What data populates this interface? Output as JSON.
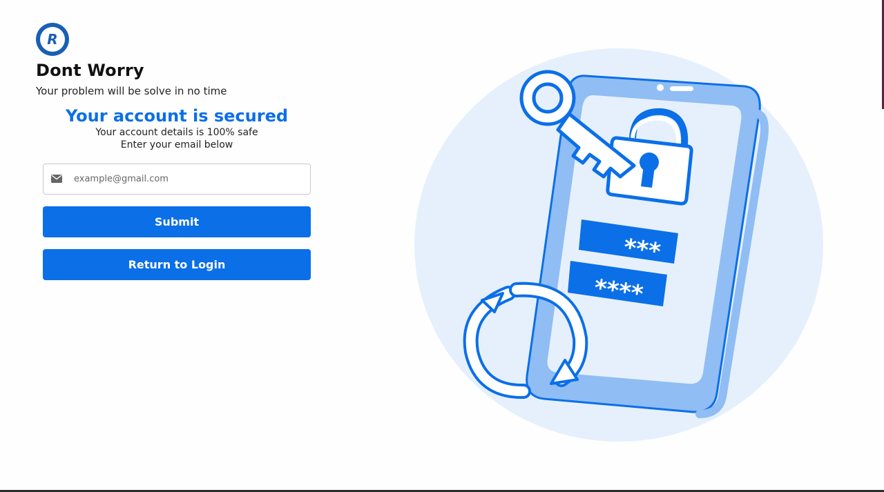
{
  "brand": {
    "logo_letter": "R",
    "logo_color": "#0b6fe8"
  },
  "header": {
    "title": "Dont Worry",
    "subtitle": "Your problem will be solve in no time"
  },
  "notice": {
    "title": "Your account is secured",
    "line1": "Your account details is 100% safe",
    "line2": "Enter your email below"
  },
  "form": {
    "email_placeholder": "example@gmail.com",
    "email_value": "",
    "email_icon": "envelope-icon",
    "submit_label": "Submit",
    "return_label": "Return to Login"
  },
  "illustration": {
    "icons": [
      "phone-icon",
      "key-icon",
      "padlock-icon",
      "password-field-icon",
      "refresh-arrows-icon"
    ],
    "password_masks": [
      "***",
      "****"
    ]
  },
  "colors": {
    "accent": "#0b6fe8",
    "illustration_light": "#e6f0fc",
    "illustration_mid": "#90bdf3"
  }
}
